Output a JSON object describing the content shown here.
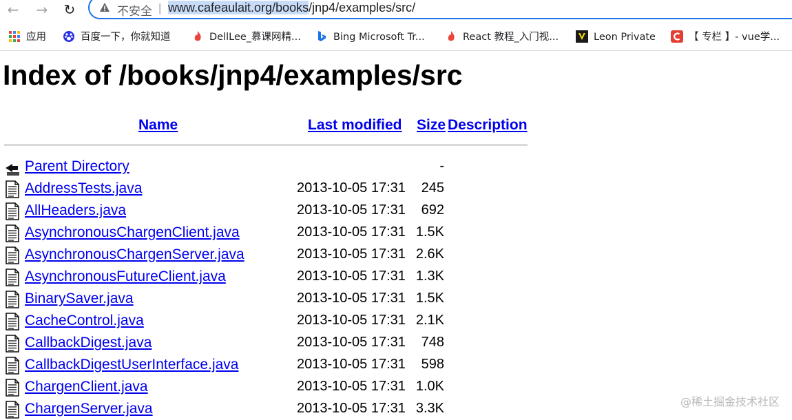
{
  "browser": {
    "insecure_label": "不安全",
    "separator": "|",
    "url_selected": "www.cafeaulait.org/books",
    "url_rest": "/jnp4/examples/src/"
  },
  "bookmarks": [
    {
      "label": "应用",
      "icon": "apps-grid-icon"
    },
    {
      "label": "百度一下，你就知道",
      "icon": "baidu-paw-icon"
    },
    {
      "label": "DellLee_慕课网精...",
      "icon": "flame-icon"
    },
    {
      "label": "Bing Microsoft Tr...",
      "icon": "bing-icon"
    },
    {
      "label": "React 教程_入门视...",
      "icon": "flame-icon"
    },
    {
      "label": "Leon Private",
      "icon": "v-logo-icon"
    },
    {
      "label": "【 专栏 】- vue学...",
      "icon": "csdn-icon"
    }
  ],
  "page": {
    "title": "Index of /books/jnp4/examples/src",
    "headers": {
      "name": "Name",
      "last_modified": "Last modified",
      "size": "Size",
      "description": "Description"
    },
    "parent": {
      "label": "Parent Directory",
      "size": "-"
    },
    "files": [
      {
        "name": "AddressTests.java",
        "modified": "2013-10-05 17:31",
        "size": "245"
      },
      {
        "name": "AllHeaders.java",
        "modified": "2013-10-05 17:31",
        "size": "692"
      },
      {
        "name": "AsynchronousChargenClient.java",
        "modified": "2013-10-05 17:31",
        "size": "1.5K"
      },
      {
        "name": "AsynchronousChargenServer.java",
        "modified": "2013-10-05 17:31",
        "size": "2.6K"
      },
      {
        "name": "AsynchronousFutureClient.java",
        "modified": "2013-10-05 17:31",
        "size": "1.3K"
      },
      {
        "name": "BinarySaver.java",
        "modified": "2013-10-05 17:31",
        "size": "1.5K"
      },
      {
        "name": "CacheControl.java",
        "modified": "2013-10-05 17:31",
        "size": "2.1K"
      },
      {
        "name": "CallbackDigest.java",
        "modified": "2013-10-05 17:31",
        "size": "748"
      },
      {
        "name": "CallbackDigestUserInterface.java",
        "modified": "2013-10-05 17:31",
        "size": "598"
      },
      {
        "name": "ChargenClient.java",
        "modified": "2013-10-05 17:31",
        "size": "1.0K"
      },
      {
        "name": "ChargenServer.java",
        "modified": "2013-10-05 17:31",
        "size": "3.3K"
      }
    ]
  },
  "watermark": "@稀土掘金技术社区",
  "colors": {
    "link": "#0000ee",
    "omnibox_border": "#1a73e8",
    "selection": "#c8dcf8"
  }
}
